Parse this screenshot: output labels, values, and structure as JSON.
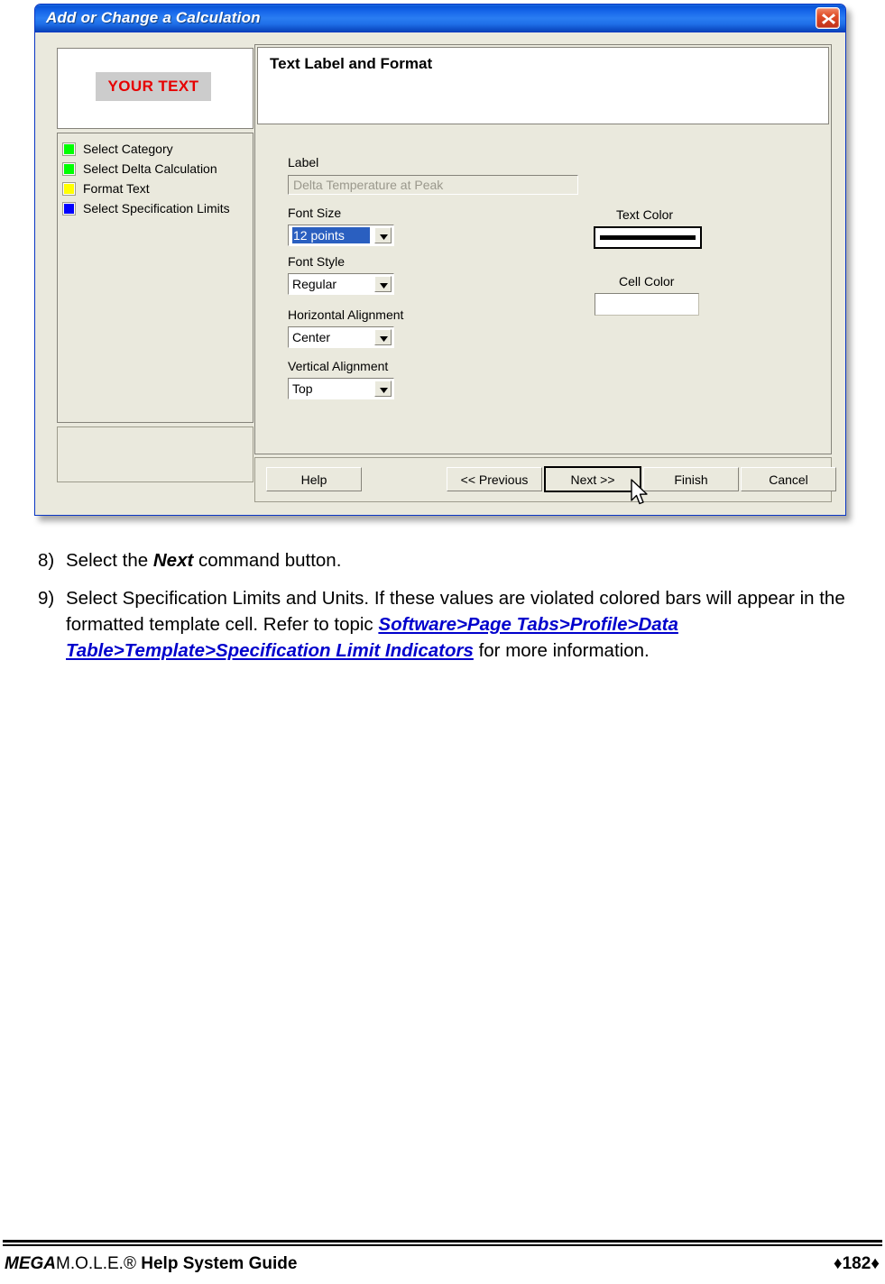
{
  "dialog": {
    "title": "Add or Change a Calculation",
    "close_icon": "close-icon",
    "preview": {
      "cell_text": "YOUR TEXT"
    },
    "checklist": [
      {
        "label": "Select Category",
        "color": "#00ff00"
      },
      {
        "label": "Select Delta Calculation",
        "color": "#00ff00"
      },
      {
        "label": "Format Text",
        "color": "#ffff00"
      },
      {
        "label": "Select Specification Limits",
        "color": "#0000ff"
      }
    ],
    "panel": {
      "header_title": "Text Label and Format",
      "label_field": {
        "label": "Label",
        "value": "Delta Temperature at Peak"
      },
      "font_size": {
        "label": "Font Size",
        "value": "12 points"
      },
      "font_style": {
        "label": "Font Style",
        "value": "Regular"
      },
      "horizontal_alignment": {
        "label": "Horizontal Alignment",
        "value": "Center"
      },
      "vertical_alignment": {
        "label": "Vertical Alignment",
        "value": "Top"
      },
      "text_color": {
        "label": "Text Color",
        "swatch_color": "#000000"
      },
      "cell_color": {
        "label": "Cell Color",
        "swatch_color": "#ffffff"
      }
    },
    "buttons": {
      "help": "Help",
      "previous": "<< Previous",
      "next": "Next >>",
      "finish": "Finish",
      "cancel": "Cancel"
    }
  },
  "document": {
    "steps": [
      {
        "number": "8)",
        "lead": "Select the ",
        "emphasis": "Next",
        "tail": " command button.",
        "link": "",
        "tail2": ""
      },
      {
        "number": "9)",
        "lead": "Select Specification Limits and Units. If these values are violated colored bars will appear in the formatted template cell. Refer to  topic ",
        "emphasis": "",
        "tail": "",
        "link": "Software>Page Tabs>Profile>Data Table>Template>Specification Limit Indicators",
        "tail2": " for more information."
      }
    ]
  },
  "footer": {
    "brand_italic": "MEGA",
    "brand_plain": "M.O.L.E.®",
    "brand_bold": " Help System Guide",
    "page": "♦182♦"
  }
}
